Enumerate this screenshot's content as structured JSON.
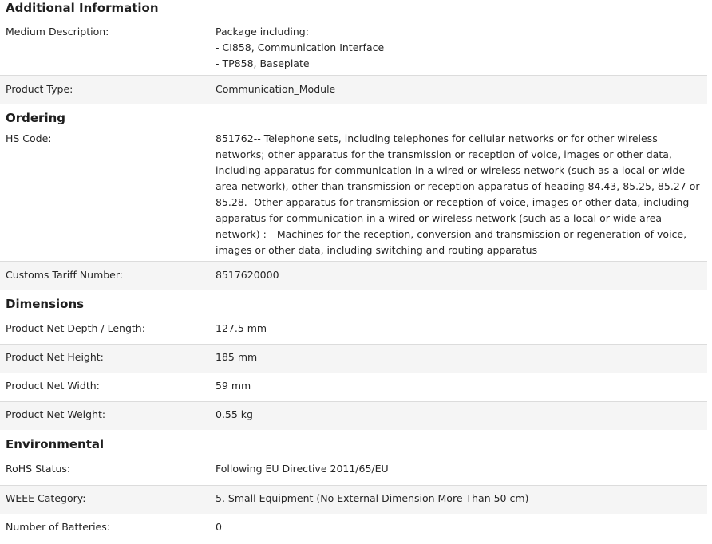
{
  "sections": {
    "additional": {
      "title": "Additional Information",
      "medium_description": {
        "label": "Medium Description:",
        "lines": [
          "Package including:",
          "- CI858, Communication Interface",
          "- TP858, Baseplate"
        ]
      },
      "product_type": {
        "label": "Product Type:",
        "value": "Communication_Module"
      }
    },
    "ordering": {
      "title": "Ordering",
      "hs_code": {
        "label": "HS Code:",
        "value": "851762-- Telephone sets, including telephones for cellular networks or for other wireless networks; other apparatus for the transmission or reception of voice, images or other data, including apparatus for communication in a wired or wireless network (such as a local or wide area network), other than transmission or reception apparatus of heading 84.43, 85.25, 85.27 or 85.28.- Other apparatus for transmission or reception of voice, images or other data, including apparatus for communication in a wired or wireless network (such as a local or wide area network) :-- Machines for the reception, conversion and transmission or regeneration of voice, images or other data, including switching and routing apparatus"
      },
      "customs_tariff": {
        "label": "Customs Tariff Number:",
        "value": "8517620000"
      }
    },
    "dimensions": {
      "title": "Dimensions",
      "depth": {
        "label": "Product Net Depth / Length:",
        "value": "127.5 mm"
      },
      "height": {
        "label": "Product Net Height:",
        "value": "185 mm"
      },
      "width": {
        "label": "Product Net Width:",
        "value": "59 mm"
      },
      "weight": {
        "label": "Product Net Weight:",
        "value": "0.55 kg"
      }
    },
    "environmental": {
      "title": "Environmental",
      "rohs": {
        "label": "RoHS Status:",
        "value": "Following EU Directive 2011/65/EU"
      },
      "weee": {
        "label": "WEEE Category:",
        "value": "5. Small Equipment (No External Dimension More Than 50 cm)"
      },
      "batteries": {
        "label": "Number of Batteries:",
        "value": "0"
      }
    }
  }
}
